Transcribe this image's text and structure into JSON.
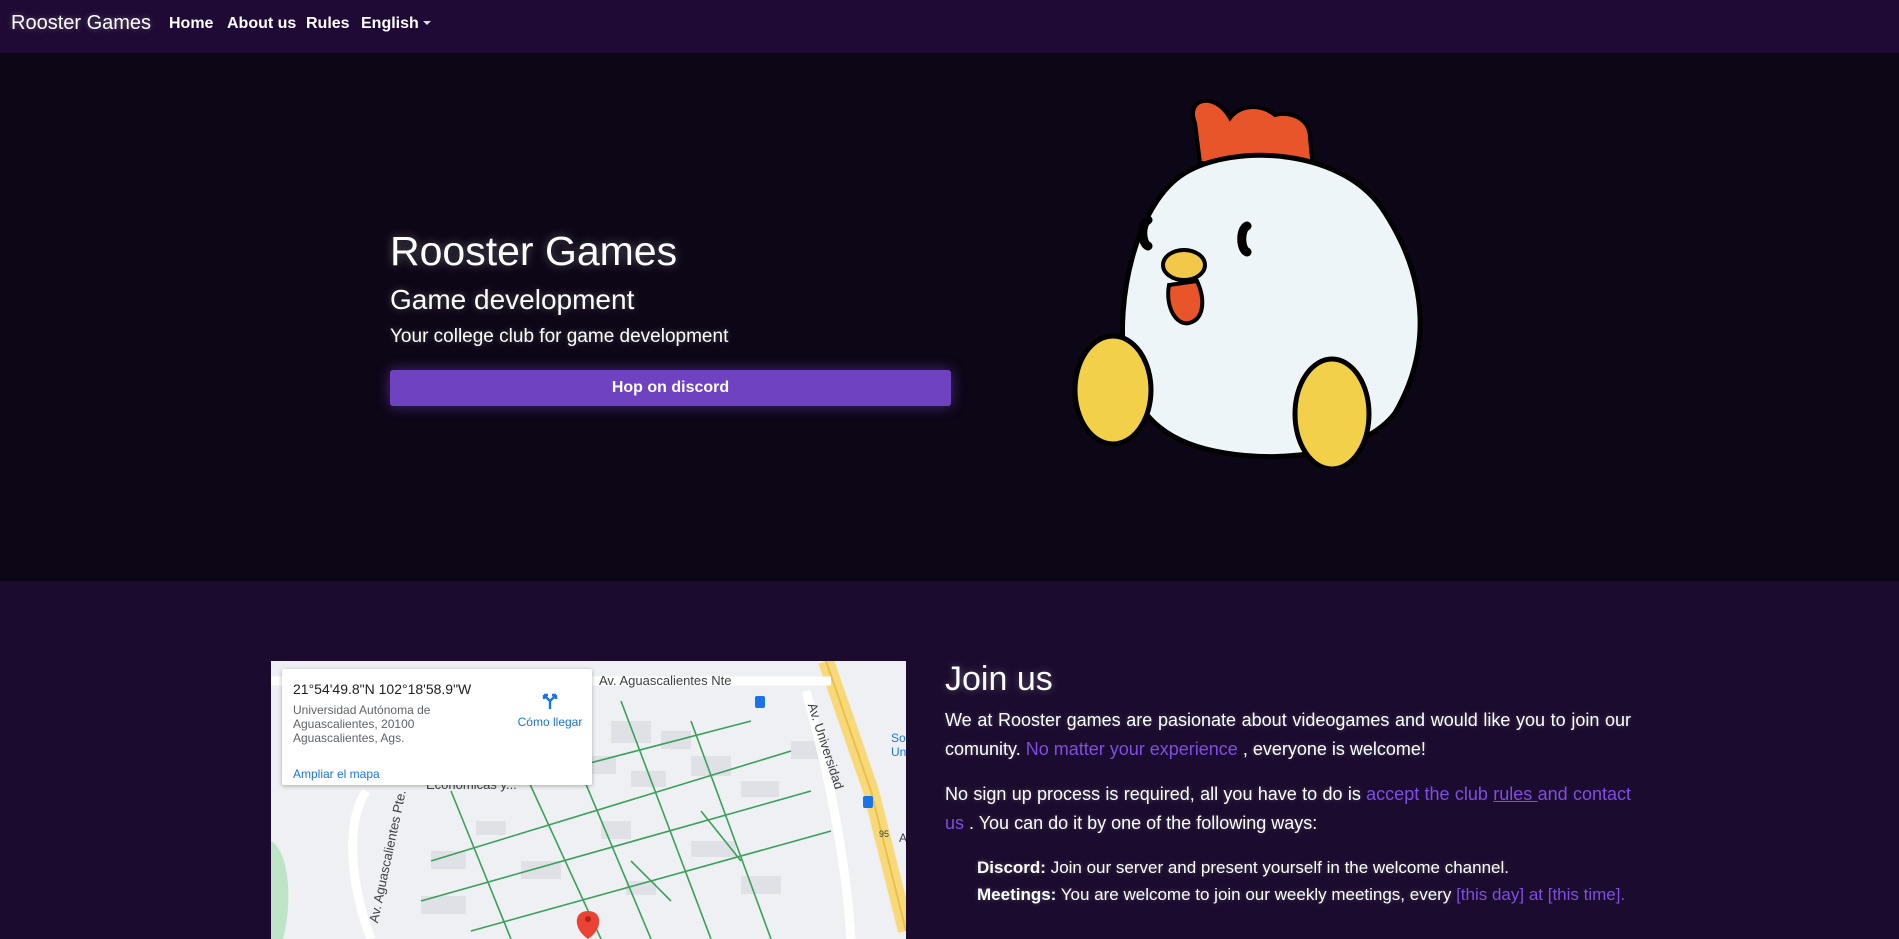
{
  "navbar": {
    "brand": "Rooster Games",
    "links": [
      "Home",
      "About us",
      "Rules"
    ],
    "language": "English"
  },
  "hero": {
    "title": "Rooster Games",
    "subtitle": "Game development",
    "tagline": "Your college club for game development",
    "button": "Hop on discord",
    "mascot_icon": "rooster-mascot"
  },
  "map": {
    "coordinates": "21°54'49.8\"N 102°18'58.9\"W",
    "address": "Universidad Autónoma de Aguascalientes, 20100 Aguascalientes, Ags.",
    "directions": "Cómo llegar",
    "enlarge": "Ampliar el mapa",
    "roads": [
      "Av. Aguascalientes Nte",
      "Av. Universidad",
      "Av. Aguascalientes Pte.",
      "Económicas y...",
      "So",
      "Un",
      "A",
      "95"
    ]
  },
  "join": {
    "title": "Join us",
    "p1_a": "We at Rooster games are pasionate about videogames and would like you to join our comunity. ",
    "p1_link": "No matter your experience",
    "p1_b": " , everyone is welcome!",
    "p2_a": "No sign up process is required, all you have to do is ",
    "p2_link1": "accept the club ",
    "p2_rules": "rules ",
    "p2_link2": "and contact us",
    "p2_b": " . You can do it by one of the following ways:",
    "discord_label": "Discord:",
    "discord_text": " Join our server and present yourself in the welcome channel.",
    "meetings_label": "Meetings:",
    "meetings_text": " You are welcome to join our weekly meetings, every ",
    "meetings_time": "[this day] at [this time]."
  },
  "colors": {
    "navbar_bg": "#1e0a35",
    "hero_bg": "#0d0616",
    "section_bg": "#1b0b2e",
    "accent": "#6f42c1",
    "link": "#7e4fe0"
  }
}
